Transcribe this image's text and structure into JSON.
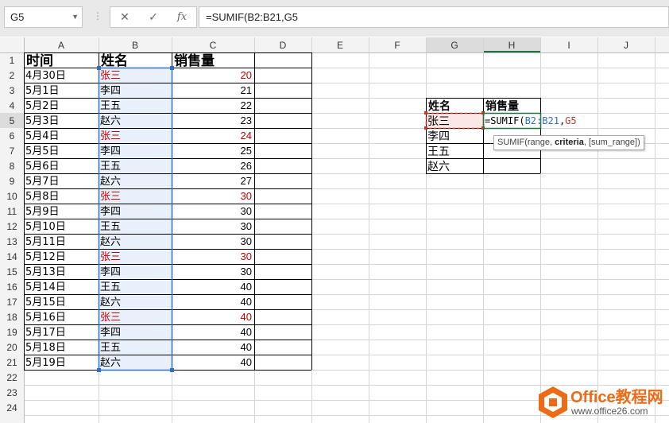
{
  "formula_bar": {
    "name_box": "G5",
    "cancel_icon": "✕",
    "enter_icon": "✓",
    "fx_label": "fx",
    "formula": "=SUMIF(B2:B21,G5"
  },
  "columns": [
    "A",
    "B",
    "C",
    "D",
    "E",
    "F",
    "G",
    "H",
    "I",
    "J"
  ],
  "rows": [
    "1",
    "2",
    "3",
    "4",
    "5",
    "6",
    "7",
    "8",
    "9",
    "10",
    "11",
    "12",
    "13",
    "14",
    "15",
    "16",
    "17",
    "18",
    "19",
    "20",
    "21",
    "22",
    "23",
    "24"
  ],
  "table": {
    "headers": [
      "时间",
      "姓名",
      "销售量"
    ],
    "rows": [
      [
        "4月30日",
        "张三",
        "20"
      ],
      [
        "5月1日",
        "李四",
        "21"
      ],
      [
        "5月2日",
        "王五",
        "22"
      ],
      [
        "5月3日",
        "赵六",
        "23"
      ],
      [
        "5月4日",
        "张三",
        "24"
      ],
      [
        "5月5日",
        "李四",
        "25"
      ],
      [
        "5月6日",
        "王五",
        "26"
      ],
      [
        "5月7日",
        "赵六",
        "27"
      ],
      [
        "5月8日",
        "张三",
        "30"
      ],
      [
        "5月9日",
        "李四",
        "30"
      ],
      [
        "5月10日",
        "王五",
        "30"
      ],
      [
        "5月11日",
        "赵六",
        "30"
      ],
      [
        "5月12日",
        "张三",
        "30"
      ],
      [
        "5月13日",
        "李四",
        "30"
      ],
      [
        "5月14日",
        "王五",
        "40"
      ],
      [
        "5月15日",
        "赵六",
        "40"
      ],
      [
        "5月16日",
        "张三",
        "40"
      ],
      [
        "5月17日",
        "李四",
        "40"
      ],
      [
        "5月18日",
        "王五",
        "40"
      ],
      [
        "5月19日",
        "赵六",
        "40"
      ]
    ]
  },
  "summary": {
    "headers": [
      "姓名",
      "销售量"
    ],
    "names": [
      "张三",
      "李四",
      "王五",
      "赵六"
    ],
    "editing_formula_prefix": "=SUMIF(",
    "editing_formula_range": "B2:B21",
    "editing_formula_sep": ",",
    "editing_formula_ref": "G5"
  },
  "tooltip": {
    "prefix": "SUMIF(range, ",
    "bold": "criteria",
    "suffix": ", [sum_range])"
  },
  "watermark": {
    "title": "Office教程网",
    "url": "www.office26.com"
  },
  "colors": {
    "highlight_name": "#c00000",
    "range_border": "#2f6fbd",
    "range_fill": "#e8f0fb",
    "ref_border": "#c0392b",
    "active_cell_green": "#217346"
  }
}
